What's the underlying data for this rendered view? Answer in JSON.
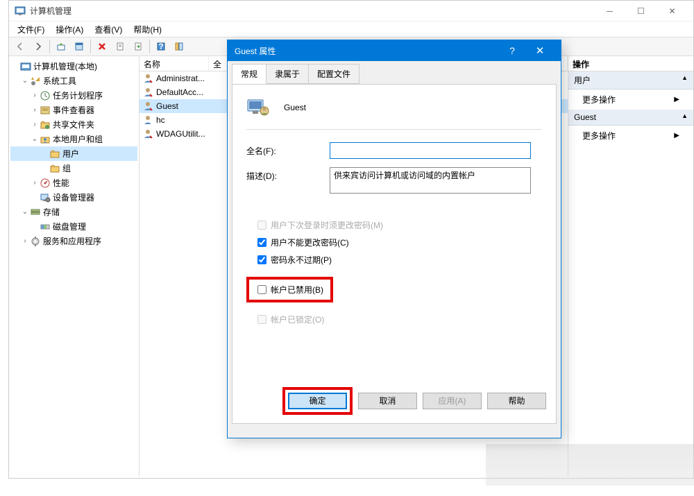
{
  "window": {
    "title": "计算机管理",
    "menu": {
      "file": "文件(F)",
      "action": "操作(A)",
      "view": "查看(V)",
      "help": "帮助(H)"
    }
  },
  "tree": {
    "root": "计算机管理(本地)",
    "system_tools": "系统工具",
    "task_scheduler": "任务计划程序",
    "event_viewer": "事件查看器",
    "shared_folders": "共享文件夹",
    "local_users": "本地用户和组",
    "users": "用户",
    "groups": "组",
    "performance": "性能",
    "device_manager": "设备管理器",
    "storage": "存储",
    "disk_mgmt": "磁盘管理",
    "services": "服务和应用程序"
  },
  "list": {
    "header_name": "名称",
    "header_full": "全",
    "items": [
      "Administrat...",
      "DefaultAcc...",
      "Guest",
      "hc",
      "WDAGUtilit..."
    ]
  },
  "actions": {
    "header": "操作",
    "group1": "用户",
    "more": "更多操作",
    "group2": "Guest"
  },
  "dialog": {
    "title": "Guest 属性",
    "tabs": {
      "general": "常规",
      "member": "隶属于",
      "profile": "配置文件"
    },
    "username": "Guest",
    "fullname_label": "全名(F):",
    "fullname_value": "",
    "desc_label": "描述(D):",
    "desc_value": "供来宾访问计算机或访问域的内置帐户",
    "chk_change_next": "用户下次登录时须更改密码(M)",
    "chk_cannot_change": "用户不能更改密码(C)",
    "chk_never_expire": "密码永不过期(P)",
    "chk_disabled": "帐户已禁用(B)",
    "chk_locked": "帐户已锁定(O)",
    "btn_ok": "确定",
    "btn_cancel": "取消",
    "btn_apply": "应用(A)",
    "btn_help": "帮助"
  }
}
